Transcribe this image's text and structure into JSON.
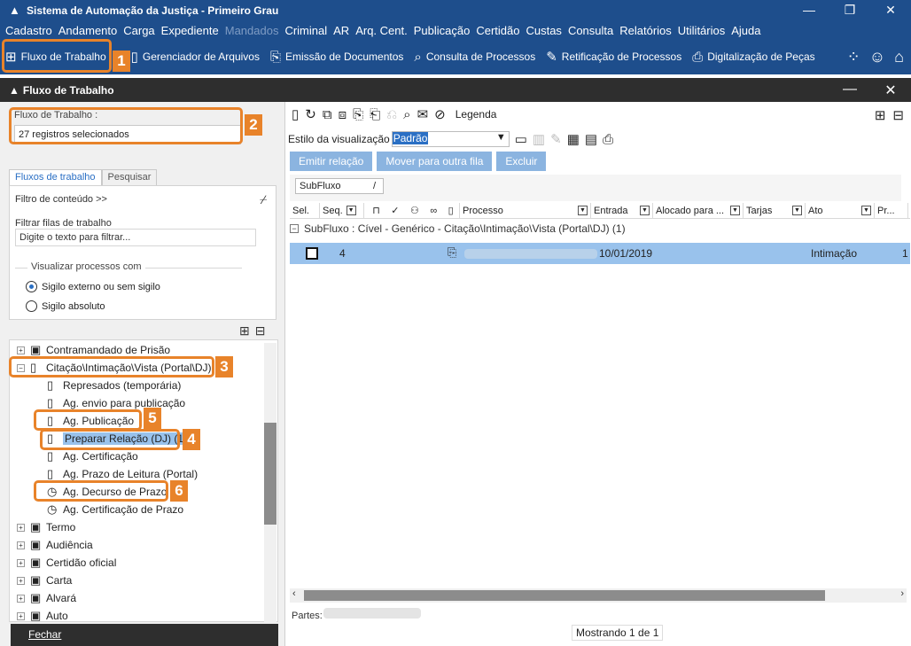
{
  "app": {
    "title": "Sistema de Automação da Justiça - Primeiro Grau",
    "window_controls": [
      "—",
      "❐",
      "✕"
    ]
  },
  "menu": [
    "Cadastro",
    "Andamento",
    "Carga",
    "Expediente",
    "Mandados",
    "Criminal",
    "AR",
    "Arq. Cent.",
    "Publicação",
    "Certidão",
    "Custas",
    "Consulta",
    "Relatórios",
    "Utilitários",
    "Ajuda"
  ],
  "menu_disabled": "Mandados",
  "toolbar": {
    "items": [
      {
        "label": "Fluxo de Trabalho",
        "icon": "flow-icon"
      },
      {
        "label": "Gerenciador de Arquivos",
        "icon": "file-manager-icon"
      },
      {
        "label": "Emissão de Documentos",
        "icon": "document-issue-icon"
      },
      {
        "label": "Consulta de Processos",
        "icon": "search-process-icon"
      },
      {
        "label": "Retificação de Processos",
        "icon": "edit-process-icon"
      },
      {
        "label": "Digitalização de Peças",
        "icon": "scanner-icon"
      }
    ]
  },
  "callouts": [
    "1",
    "2",
    "3",
    "4",
    "5",
    "6"
  ],
  "subwindow": {
    "title": "Fluxo de Trabalho"
  },
  "left": {
    "fluxo_label": "Fluxo de Trabalho :",
    "fluxo_value": "27 registros selecionados",
    "tabs": [
      "Fluxos de trabalho",
      "Pesquisar"
    ],
    "filtro_conteudo": "Filtro de conteúdo >>",
    "filtrar_label": "Filtrar filas de trabalho",
    "filtrar_placeholder": "Digite o texto para filtrar...",
    "visualizar_label": "Visualizar processos com",
    "radio_externo": "Sigilo externo ou sem sigilo",
    "radio_absoluto": "Sigilo absoluto",
    "fechar": "Fechar"
  },
  "tree": [
    {
      "label": "Contramandado de Prisão",
      "level": 0,
      "expander": "+",
      "icon": "folder-doc-icon"
    },
    {
      "label": "Citação\\Intimação\\Vista (Portal\\DJ)",
      "level": 0,
      "expander": "−",
      "icon": "doc-icon"
    },
    {
      "label": "Represados (temporária)",
      "level": 1,
      "icon": "doc-icon"
    },
    {
      "label": "Ag. envio para publicação",
      "level": 1,
      "icon": "doc-icon"
    },
    {
      "label": "Ag. Publicação",
      "level": 1,
      "icon": "doc-icon"
    },
    {
      "label": "Preparar Relação (DJ) (1)",
      "level": 1,
      "icon": "doc-icon",
      "selected": true
    },
    {
      "label": "Ag. Certificação",
      "level": 1,
      "icon": "doc-icon"
    },
    {
      "label": "Ag. Prazo de Leitura (Portal)",
      "level": 1,
      "icon": "doc-icon"
    },
    {
      "label": "Ag. Decurso de Prazo",
      "level": 1,
      "icon": "timer-icon"
    },
    {
      "label": "Ag. Certificação de Prazo",
      "level": 1,
      "icon": "timer-icon"
    },
    {
      "label": "Termo",
      "level": 0,
      "expander": "+",
      "icon": "folder-doc-icon"
    },
    {
      "label": "Audiência",
      "level": 0,
      "expander": "+",
      "icon": "folder-doc-icon"
    },
    {
      "label": "Certidão oficial",
      "level": 0,
      "expander": "+",
      "icon": "folder-doc-icon"
    },
    {
      "label": "Carta",
      "level": 0,
      "expander": "+",
      "icon": "folder-doc-icon"
    },
    {
      "label": "Alvará",
      "level": 0,
      "expander": "+",
      "icon": "folder-doc-icon"
    },
    {
      "label": "Auto",
      "level": 0,
      "expander": "+",
      "icon": "folder-doc-icon"
    }
  ],
  "right": {
    "legenda": "Legenda",
    "estilo_label": "Estilo da visualização",
    "estilo_value": "Padrão",
    "buttons": [
      "Emitir relação",
      "Mover para outra fila",
      "Excluir"
    ],
    "group_tag": "SubFluxo",
    "columns": [
      "Sel.",
      "Seq.",
      "Processo",
      "Entrada",
      "Alocado para ...",
      "Tarjas",
      "Ato",
      "Pr..."
    ],
    "group_row": "SubFluxo : Cível - Genérico - Citação\\Intimação\\Vista (Portal\\DJ)  (1)",
    "row": {
      "seq": "4",
      "entrada": "10/01/2019",
      "ato": "Intimação",
      "last": "1"
    },
    "partes_label": "Partes:",
    "status": "Mostrando 1 de 1"
  }
}
